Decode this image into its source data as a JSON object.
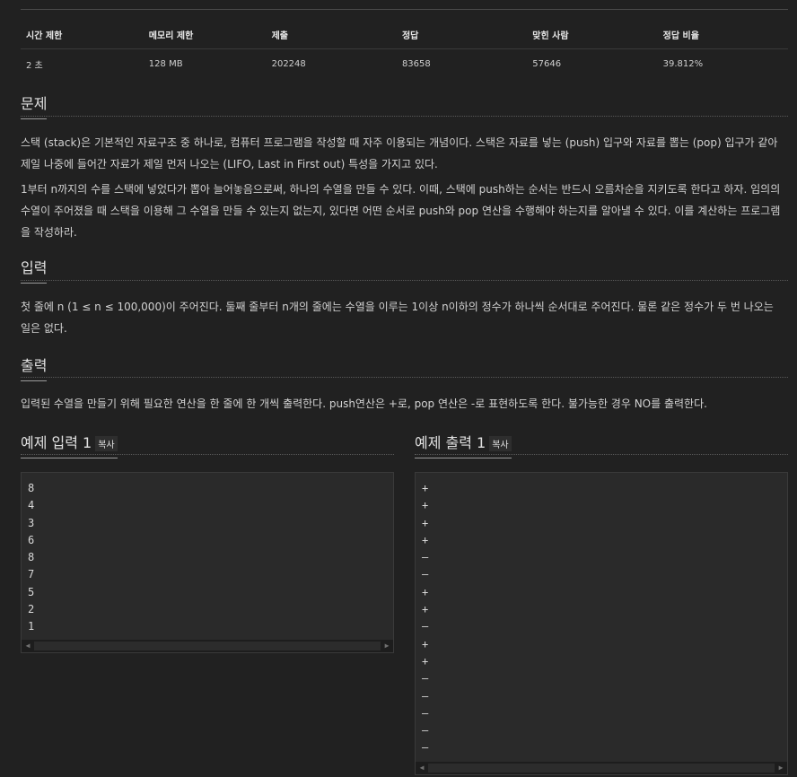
{
  "info_table": {
    "headers": [
      "시간 제한",
      "메모리 제한",
      "제출",
      "정답",
      "맞힌 사람",
      "정답 비율"
    ],
    "values": [
      "2 초",
      "128 MB",
      "202248",
      "83658",
      "57646",
      "39.812%"
    ]
  },
  "sections": {
    "problem": {
      "title": "문제",
      "paragraphs": [
        "스택 (stack)은 기본적인 자료구조 중 하나로, 컴퓨터 프로그램을 작성할 때 자주 이용되는 개념이다. 스택은 자료를 넣는 (push) 입구와 자료를 뽑는 (pop) 입구가 같아 제일 나중에 들어간 자료가 제일 먼저 나오는 (LIFO, Last in First out) 특성을 가지고 있다.",
        "1부터 n까지의 수를 스택에 넣었다가 뽑아 늘어놓음으로써, 하나의 수열을 만들 수 있다. 이때, 스택에 push하는 순서는 반드시 오름차순을 지키도록 한다고 하자. 임의의 수열이 주어졌을 때 스택을 이용해 그 수열을 만들 수 있는지 없는지, 있다면 어떤 순서로 push와 pop 연산을 수행해야 하는지를 알아낼 수 있다. 이를 계산하는 프로그램을 작성하라."
      ]
    },
    "input": {
      "title": "입력",
      "text": "첫 줄에 n (1 ≤ n ≤ 100,000)이 주어진다. 둘째 줄부터 n개의 줄에는 수열을 이루는 1이상 n이하의 정수가 하나씩 순서대로 주어진다. 물론 같은 정수가 두 번 나오는 일은 없다."
    },
    "output": {
      "title": "출력",
      "text": "입력된 수열을 만들기 위해 필요한 연산을 한 줄에 한 개씩 출력한다. push연산은 +로, pop 연산은 -로 표현하도록 한다. 불가능한 경우 NO를 출력한다."
    }
  },
  "examples": {
    "copy_label": "복사",
    "input": {
      "title": "예제 입력 1",
      "lines": [
        "8",
        "4",
        "3",
        "6",
        "8",
        "7",
        "5",
        "2",
        "1"
      ]
    },
    "output": {
      "title": "예제 출력 1",
      "lines": [
        "+",
        "+",
        "+",
        "+",
        "–",
        "–",
        "+",
        "+",
        "–",
        "+",
        "+",
        "–",
        "–",
        "–",
        "–",
        "–"
      ]
    }
  }
}
